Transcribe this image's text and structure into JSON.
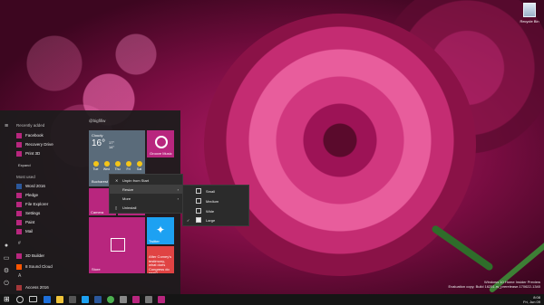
{
  "desktop": {
    "recycle_bin": "Recycle Bin",
    "watermark_line1": "Windows 10 Home Insider Preview",
    "watermark_line2": "Evaluation copy. Build 16251.rs_prerelease.170622-1340"
  },
  "start_menu": {
    "recently_added_header": "Recently added",
    "recent_apps": [
      "Facebook",
      "Recovery Drive",
      "Print 3D"
    ],
    "expand_label": "Expand",
    "most_used_header": "Most used",
    "most_used_apps": [
      "Word 2016",
      "Pledge",
      "File Explorer",
      "Settings",
      "Paint",
      "Mail"
    ],
    "letter_hash": "#",
    "hash_apps": [
      "3D Builder",
      "8 Sound Cloud"
    ],
    "letter_a": "A",
    "a_apps": [
      "Access 2016"
    ],
    "tiles_header": "@bigfifiw",
    "weather": {
      "condition": "Cloudy",
      "temp": "16°",
      "hi": "17°",
      "lo": "14°",
      "location": "Bucharest",
      "days": [
        "Tue",
        "Wed",
        "Thu",
        "Fri",
        "Sat"
      ]
    },
    "tiles": {
      "groove": "Groove Music",
      "camera": "Camera",
      "movies": "Movies & TV",
      "store": "Store",
      "twitter": "Twitter",
      "news": "After Comey's testimony, what does Congress do next?"
    }
  },
  "context_menu": {
    "items": [
      "Unpin from Start",
      "Resize",
      "More",
      "Uninstall"
    ]
  },
  "resize_submenu": {
    "items": [
      "Small",
      "Medium",
      "Wide",
      "Large"
    ],
    "checked": "Large"
  },
  "taskbar": {
    "time": "8:08",
    "date": "Fri, Jun 09"
  },
  "colors": {
    "accent": "#b8267e",
    "twitter": "#1da1f2",
    "news": "#e04343"
  }
}
